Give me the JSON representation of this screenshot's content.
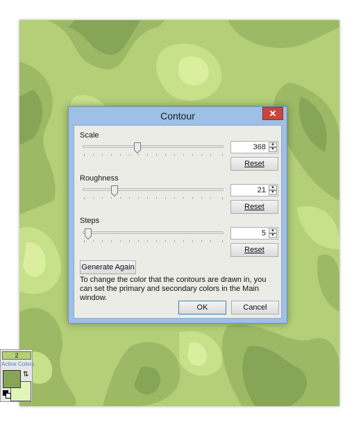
{
  "dialog": {
    "title": "Contour",
    "close_glyph": "✕",
    "scale": {
      "label": "Scale",
      "value": "368",
      "slider_fraction": 0.37,
      "reset_label": "Reset"
    },
    "roughness": {
      "label": "Roughness",
      "value": "21",
      "slider_fraction": 0.21,
      "reset_label": "Reset"
    },
    "steps": {
      "label": "Steps",
      "value": "5",
      "slider_fraction": 0.0,
      "reset_label": "Reset"
    },
    "generate_label": "Generate Again",
    "info_text": "To change the color that the contours are drawn in, you can set the primary and secondary colors in the Main window.",
    "ok_label": "OK",
    "cancel_label": "Cancel"
  },
  "palette": {
    "count": "2",
    "caption": "Active Colors",
    "primary_color": "#87a556",
    "secondary_color": "#e2f5b9",
    "swap_icon": "swap-arrows-icon",
    "reset_icon": "reset-colors-icon"
  },
  "canvas": {
    "colors": [
      "#87a556",
      "#9cba66",
      "#b3cf77",
      "#c7e18a",
      "#d9ef9f"
    ]
  }
}
